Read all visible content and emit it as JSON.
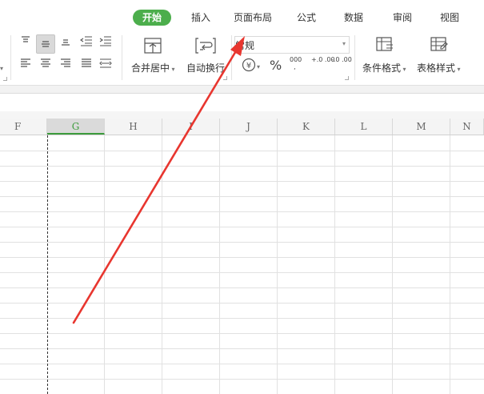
{
  "tabs": [
    "开始",
    "插入",
    "页面布局",
    "公式",
    "数据",
    "审阅",
    "视图"
  ],
  "ribbon": {
    "merge_label": "合并居中",
    "wrap_label": "自动换行",
    "number_format": "常规",
    "currency_symbol": "¥",
    "percent_symbol": "%",
    "thousands_symbol": "000",
    "dec_increase": "+.0 .00",
    "dec_decrease": "-.0 .00",
    "cond_format_label": "条件格式",
    "table_style_label": "表格样式"
  },
  "columns": [
    "F",
    "G",
    "H",
    "I",
    "J",
    "K",
    "L",
    "M",
    "N"
  ],
  "selected_column": "G",
  "annotation": {
    "type": "arrow",
    "color": "#e8362f",
    "points_to": "页面布局"
  }
}
